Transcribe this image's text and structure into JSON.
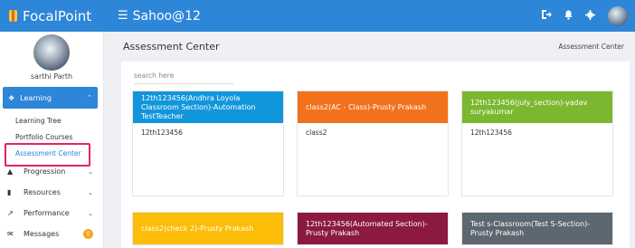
{
  "app": {
    "brand": "FocalPoint",
    "user": "Sahoo@12"
  },
  "colors": {
    "primary": "#2d86d8",
    "highlight": "#e4245f",
    "badge": "#f5a623"
  },
  "topbar": {
    "icons": [
      "logout-icon",
      "bell-icon",
      "gear-icon",
      "user-avatar"
    ]
  },
  "sidebar": {
    "profile_name": "sarthi Parth",
    "active_section": "Learning",
    "learning_items": [
      "Learning Tree",
      "Portfolio Courses",
      "Assessment Center"
    ],
    "items": [
      {
        "label": "Progression",
        "icon": "graduation-cap-icon"
      },
      {
        "label": "Resources",
        "icon": "book-icon"
      },
      {
        "label": "Performance",
        "icon": "trend-icon"
      },
      {
        "label": "Messages",
        "icon": "mail-icon",
        "badge": "0"
      }
    ]
  },
  "page": {
    "title": "Assessment Center",
    "breadcrumb": "Assessment Center",
    "search_placeholder": "search here"
  },
  "cards": [
    {
      "title": "12th123456(Andhra Loyola Classroom Section)-Automation TestTeacher",
      "body": "12th123456",
      "color": "#1296db"
    },
    {
      "title": "class2(AC - Class)-Prusty Prakash",
      "body": "class2",
      "color": "#f2711c"
    },
    {
      "title": "12th123456(july_section)-yadav suryakumar",
      "body": "12th123456",
      "color": "#7cb82f"
    },
    {
      "title": "class2(check 2)-Prusty Prakash",
      "body": "",
      "color": "#fbbd08"
    },
    {
      "title": "12th123456(Automated Section)-Prusty Prakash",
      "body": "",
      "color": "#8b1a3e"
    },
    {
      "title": "Test s-Classroom(Test S-Section)-Prusty Prakash",
      "body": "",
      "color": "#5d6770"
    }
  ]
}
